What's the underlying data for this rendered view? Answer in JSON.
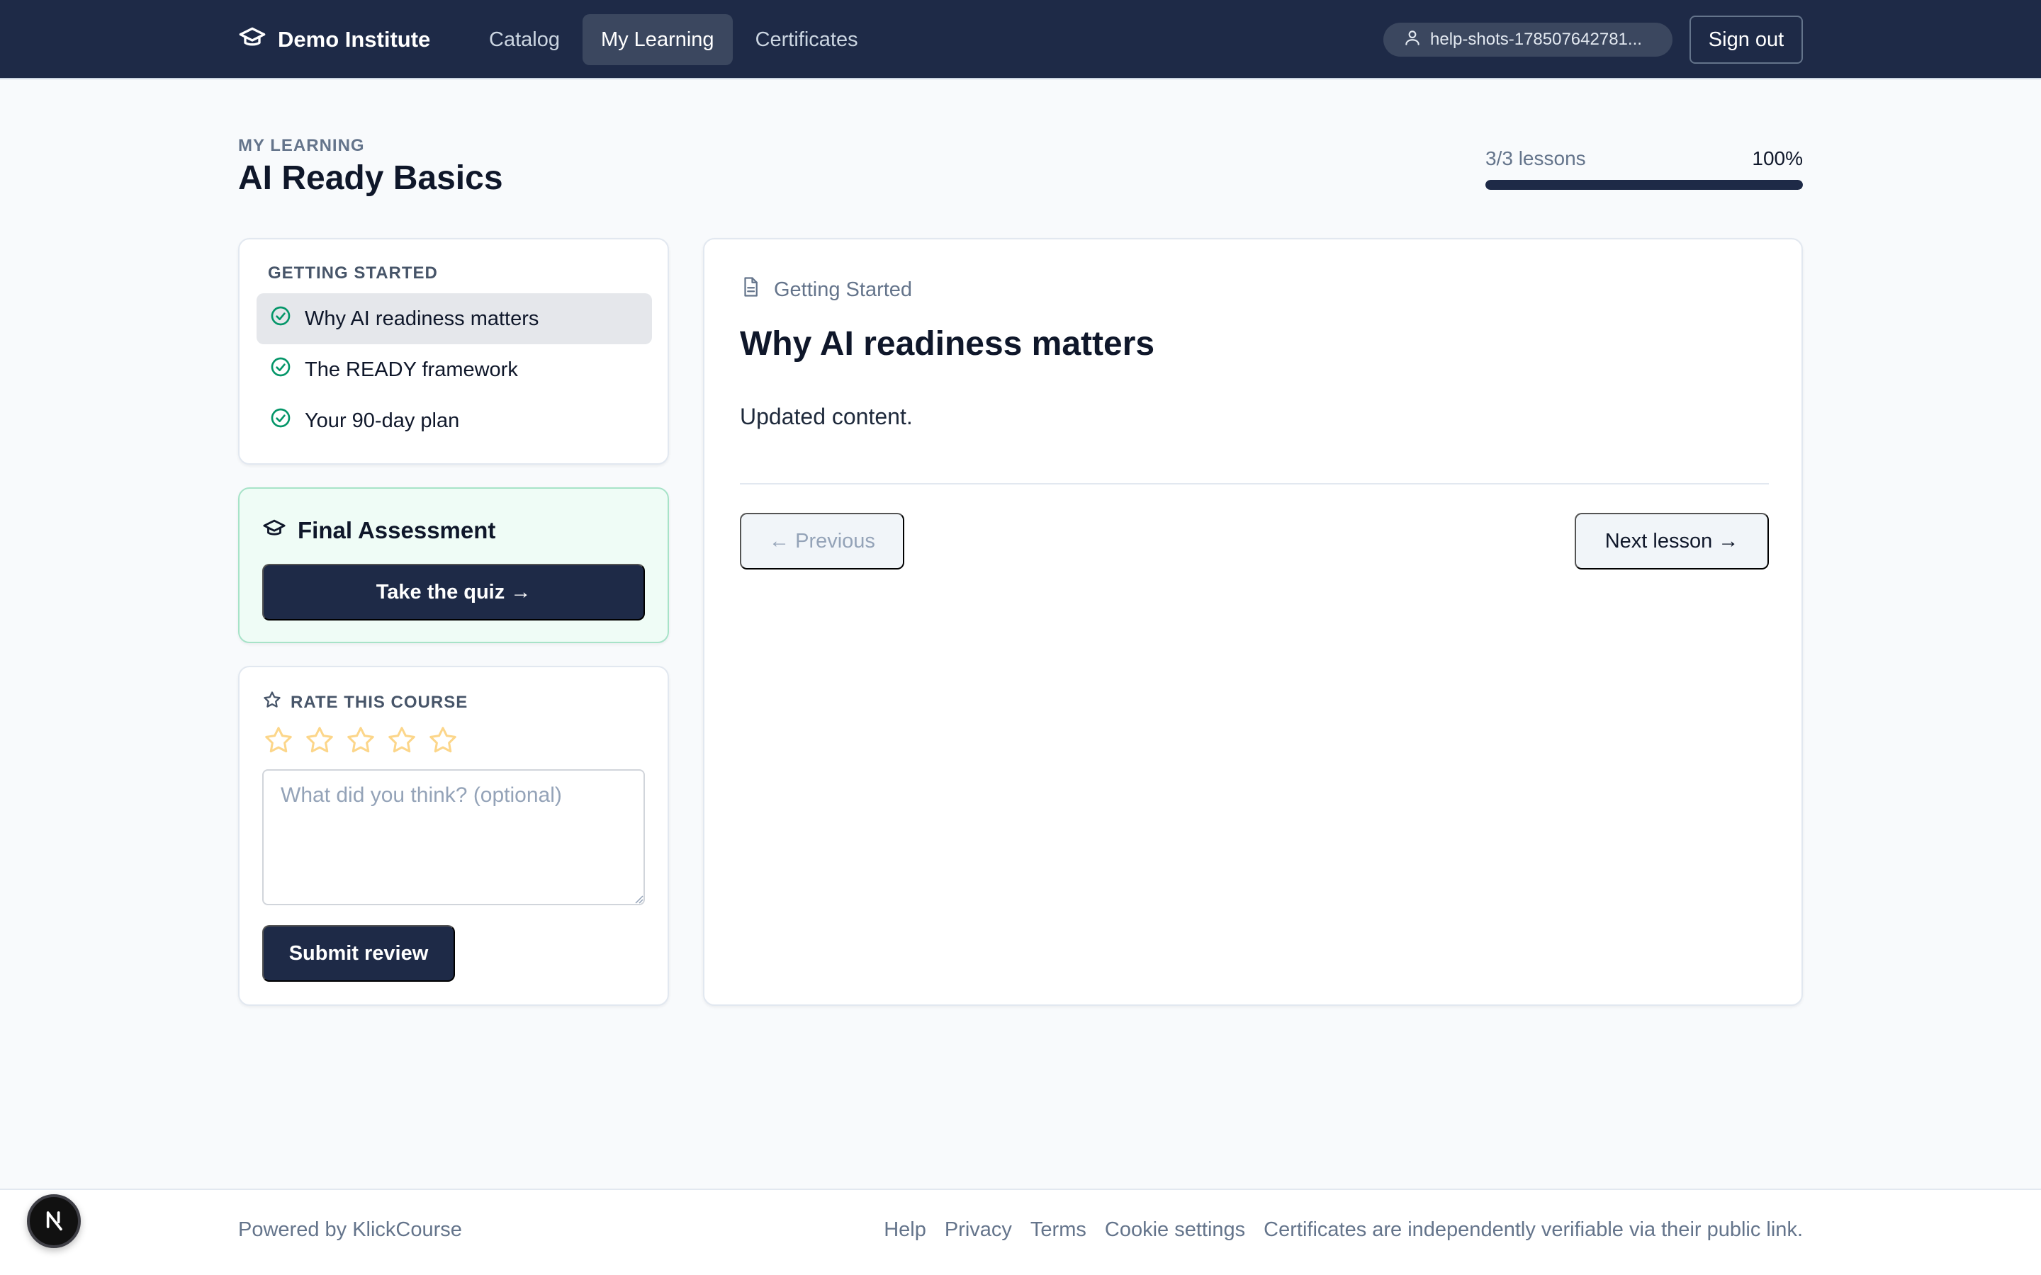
{
  "header": {
    "brand": "Demo Institute",
    "nav": [
      {
        "label": "Catalog",
        "active": false
      },
      {
        "label": "My Learning",
        "active": true
      },
      {
        "label": "Certificates",
        "active": false
      }
    ],
    "user": "help-shots-178507642781...",
    "sign_out": "Sign out"
  },
  "page": {
    "eyebrow": "MY LEARNING",
    "title": "AI Ready Basics",
    "progress": {
      "count_label": "3/3 lessons",
      "percent_label": "100%",
      "fraction": 1.0
    }
  },
  "sidebar": {
    "section": "GETTING STARTED",
    "lessons": [
      {
        "label": "Why AI readiness matters",
        "completed": true,
        "active": true
      },
      {
        "label": "The READY framework",
        "completed": true,
        "active": false
      },
      {
        "label": "Your 90-day plan",
        "completed": true,
        "active": false
      }
    ],
    "assessment": {
      "title": "Final Assessment",
      "button": "Take the quiz →"
    },
    "rating": {
      "label": "RATE THIS COURSE",
      "stars": 5,
      "selected": 0,
      "placeholder": "What did you think? (optional)",
      "value": "",
      "submit": "Submit review"
    }
  },
  "lesson": {
    "breadcrumb": "Getting Started",
    "title": "Why AI readiness matters",
    "body": "Updated content.",
    "prev": "← Previous",
    "next": "Next lesson →"
  },
  "footer": {
    "powered": "Powered by KlickCourse",
    "links": [
      "Help",
      "Privacy",
      "Terms",
      "Cookie settings",
      "Certificates are independently verifiable via their public link."
    ]
  },
  "colors": {
    "header_bg": "#1e2a47",
    "accent_green": "#059669",
    "assessment_bg": "#effcf6",
    "star_outline": "#fcd68a"
  },
  "icons": {
    "brand": "graduation-cap-icon",
    "user": "user-icon",
    "lesson_done": "check-circle-icon",
    "assessment": "graduation-cap-icon",
    "rating": "star-icon",
    "breadcrumb": "document-icon",
    "dev_badge": "nextjs-icon"
  }
}
